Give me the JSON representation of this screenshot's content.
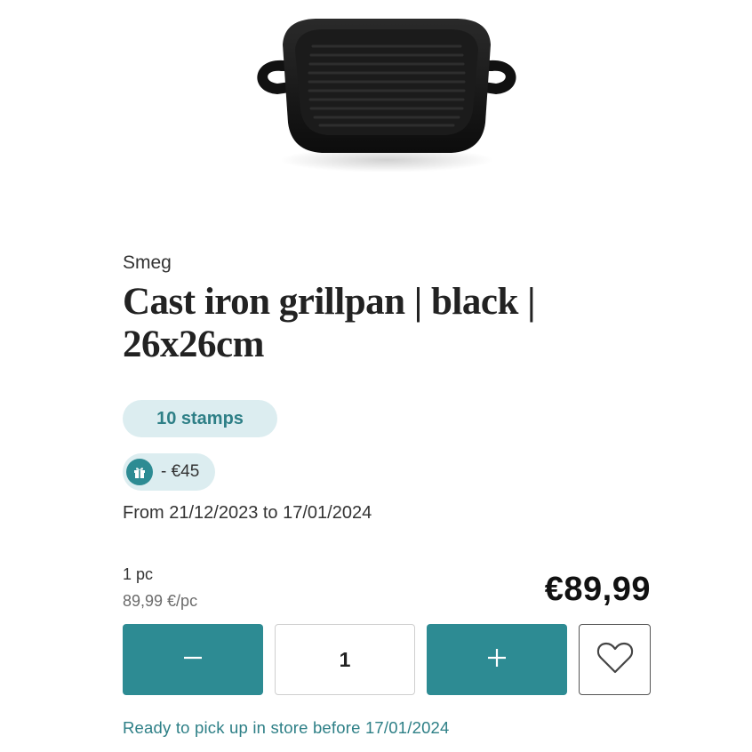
{
  "product": {
    "brand": "Smeg",
    "title_line1": "Cast iron grillpan | black |",
    "title_line2": "26x26cm",
    "image_alt": "Cast iron grillpan black",
    "image_icon": "grill-pan-image"
  },
  "stamps": {
    "label": "10 stamps"
  },
  "discount": {
    "label": "- €45",
    "icon": "gift-icon"
  },
  "promo": {
    "date_range": "From 21/12/2023 to 17/01/2024"
  },
  "pricing": {
    "unit": "1 pc",
    "unit_price": "89,99 €/pc",
    "price": "€89,99"
  },
  "quantity": {
    "value": "1",
    "decrease_icon": "minus-icon",
    "increase_icon": "plus-icon"
  },
  "favorite": {
    "icon": "heart-icon"
  },
  "pickup": {
    "label": "Ready to pick up in store before 17/01/2024"
  },
  "colors": {
    "accent": "#2d8b93",
    "accent_text": "#2d7f86",
    "badge_bg": "#dcedf0"
  }
}
